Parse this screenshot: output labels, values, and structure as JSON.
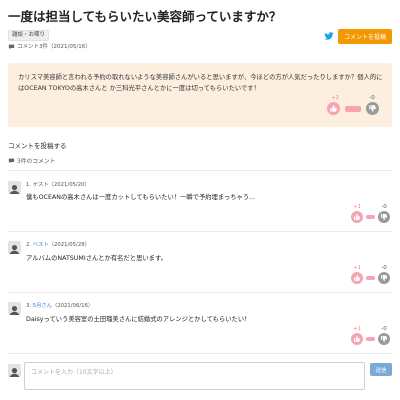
{
  "page": {
    "title": "一度は担当してもらいたい美容師っていますか？",
    "category_tag": "雑談・お喋り",
    "meta": "コメント3件（2021/05/16）",
    "post_button_label": "コメントを投稿",
    "body": "カリスマ美容師と言われる予約の取れないような美容師さんがいると思いますが、今ほどの方が人気だったりしますか？個人的にはOCEAN TOKYOの高木さんと か三科光平さんとかに一度は切ってもらいたいです！",
    "votes": {
      "plus": "+2",
      "minus": "-0",
      "plus_share": 1.0
    }
  },
  "comment_section": {
    "post_comment_link": "コメントを投稿する",
    "count_label": "3件のコメント"
  },
  "comments": [
    {
      "header": "1. ゲスト（2021/05/20）",
      "number": "",
      "name": "",
      "date": "",
      "body": "僕もOCEANの高木さんは一度カットしてもらいたい！一瞬で予約埋まっちゃう...",
      "plus": "+1",
      "minus": "-0",
      "plus_share": 1.0
    },
    {
      "header": "",
      "number": "2.",
      "name": "ベスト",
      "date": "（2021/05/28）",
      "body": "アルバムのNATSUMIさんとか有名だと思います。",
      "plus": "+1",
      "minus": "-0",
      "plus_share": 1.0
    },
    {
      "header": "",
      "number": "3.",
      "name": "5月さん",
      "date": "（2021/06/16）",
      "body": "Daisyっていう美容室の土田瑠美さんに結婚式のアレンジとかしてもらいたい！",
      "plus": "+1",
      "minus": "-0",
      "plus_share": 1.0
    }
  ],
  "comment_form": {
    "placeholder": "コメントを入力（10文字以上）",
    "submit_label": "送信"
  },
  "colors": {
    "accent": "#f39800",
    "post_bg": "#fcefe0",
    "plus": "#ff7a8e",
    "link": "#3a7bd5",
    "twitter": "#1da1f2",
    "send": "#7aa9d6"
  },
  "icons": [
    "twitter-icon",
    "chat-icon",
    "thumbs-up-icon",
    "thumbs-down-icon",
    "user-avatar-icon"
  ]
}
